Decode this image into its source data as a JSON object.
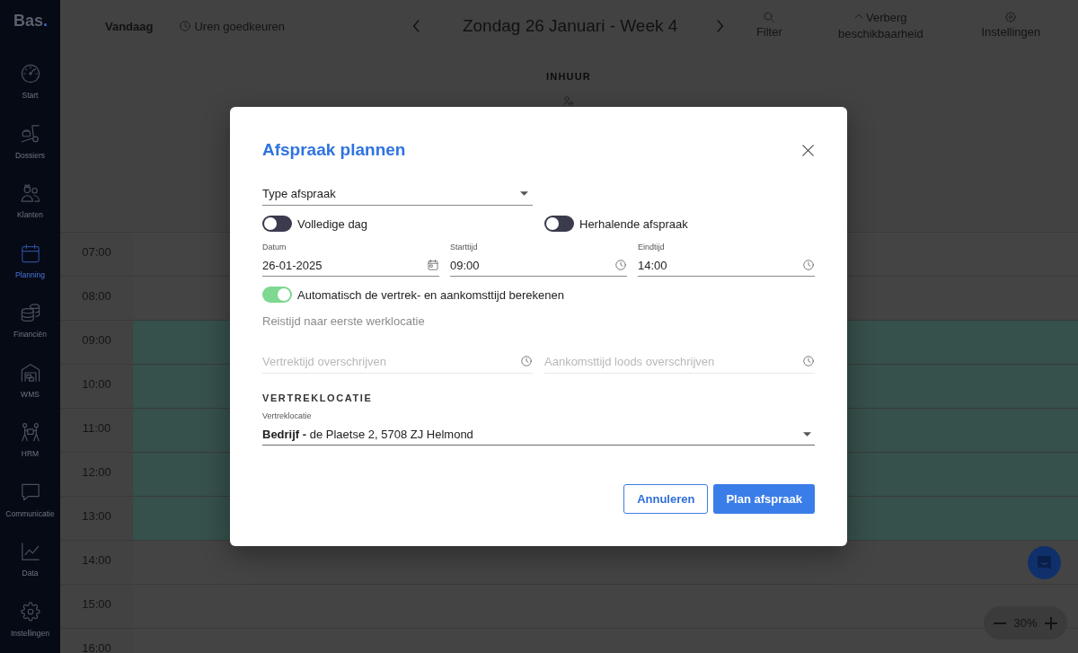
{
  "sidebar": {
    "logo": "Bas.",
    "items": [
      {
        "label": "Start",
        "selected": false
      },
      {
        "label": "Dossiers",
        "selected": false
      },
      {
        "label": "Klanten",
        "selected": false
      },
      {
        "label": "Planning",
        "selected": true
      },
      {
        "label": "Financiën",
        "selected": false
      },
      {
        "label": "WMS",
        "selected": false
      },
      {
        "label": "HRM",
        "selected": false
      },
      {
        "label": "Communicatie",
        "selected": false
      },
      {
        "label": "Data",
        "selected": false
      },
      {
        "label": "Instellingen",
        "selected": false
      }
    ]
  },
  "toolbar": {
    "today": "Vandaag",
    "approve_hours": "Uren goedkeuren",
    "title": "Zondag 26 Januari - Week 4",
    "actions": [
      {
        "label": "Filter",
        "kind": "stacked"
      },
      {
        "label": "Verberg beschikbaarheid",
        "kind": "inline"
      },
      {
        "label": "Instellingen",
        "kind": "stacked"
      }
    ]
  },
  "calendar": {
    "column": "INHUUR",
    "rows": [
      {
        "time": "07:00",
        "available": false
      },
      {
        "time": "08:00",
        "available": false
      },
      {
        "time": "09:00",
        "available": true
      },
      {
        "time": "10:00",
        "available": true
      },
      {
        "time": "11:00",
        "available": true
      },
      {
        "time": "12:00",
        "available": true
      },
      {
        "time": "13:00",
        "available": true
      },
      {
        "time": "14:00",
        "available": false
      },
      {
        "time": "15:00",
        "available": false
      },
      {
        "time": "16:00",
        "available": false
      }
    ]
  },
  "modal": {
    "title": "Afspraak plannen",
    "type_select": {
      "label": "Type afspraak"
    },
    "toggles": [
      {
        "label": "Volledige dag",
        "on": false
      },
      {
        "label": "Herhalende afspraak",
        "on": false
      }
    ],
    "fields": [
      {
        "label": "Datum",
        "value": "26-01-2025",
        "kind": "date"
      },
      {
        "label": "Starttijd",
        "value": "09:00",
        "kind": "time"
      },
      {
        "label": "Eindtijd",
        "value": "14:00",
        "kind": "time"
      }
    ],
    "auto_toggle": {
      "label": "Automatisch de vertrek- en aankomsttijd berekenen",
      "on": true
    },
    "travel_note": "Reistijd naar eerste werklocatie",
    "override_fields": [
      {
        "placeholder": "Vertrektijd overschrijven",
        "disabled": true
      },
      {
        "placeholder": "Aankomsttijd loods overschrijven",
        "disabled": true
      }
    ],
    "section_title": "VERTREKLOCATIE",
    "location": {
      "label": "Vertreklocatie",
      "value": "**Bedrijf -** de Plaetse 2, 5708 ZJ Helmond"
    },
    "buttons": [
      {
        "label": "Annuleren",
        "kind": "secondary"
      },
      {
        "label": "Plan afspraak",
        "kind": "primary"
      }
    ]
  },
  "zoom": {
    "value": "30%"
  }
}
